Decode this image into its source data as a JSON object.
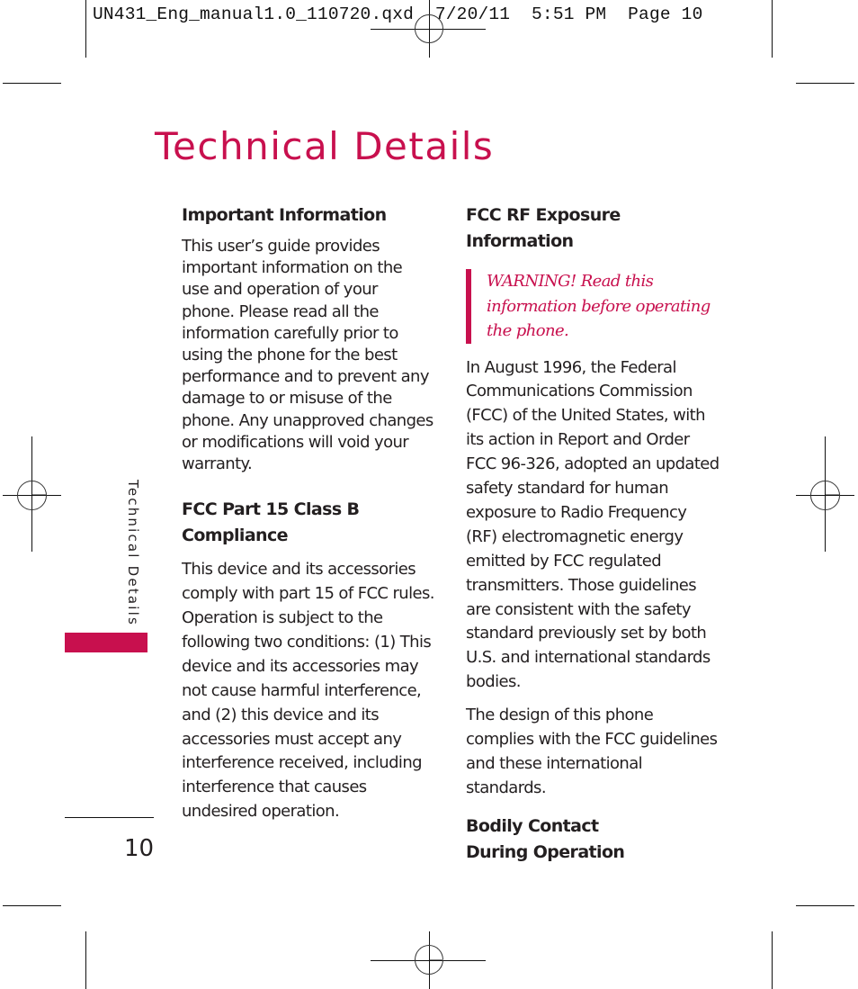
{
  "print_slug": {
    "filename": "UN431_Eng_manual1.0_110720.qxd",
    "date": "7/20/11",
    "time": "5:51 PM",
    "page_label": "Page 10"
  },
  "page": {
    "title": "Technical Details",
    "side_label": "Technical Details",
    "page_number": "10",
    "accent_color": "#c8104e"
  },
  "left_column": {
    "sections": [
      {
        "heading": "Important Information",
        "body": "This user’s guide provides important information on the use and operation of your phone. Please read all the information carefully prior to using the phone for the best performance and to prevent any damage to or misuse of the phone. Any unapproved changes or modifications will void your warranty."
      },
      {
        "heading": "FCC Part 15 Class B Compliance",
        "body": "This device and its accessories comply with part 15 of FCC rules. Operation is subject to the following two conditions: (1) This device and its accessories may not cause harmful interference, and (2) this device and its accessories must accept any interference received, including interference that causes undesired operation."
      }
    ]
  },
  "right_column": {
    "heading": "FCC RF Exposure Information",
    "warning": "WARNING! Read this information before operating the phone.",
    "paragraphs": [
      "In August 1996, the Federal Communications Commission (FCC) of the United States, with its action in Report and Order FCC 96-326, adopted an updated safety standard for human exposure to Radio Frequency (RF) electromagnetic energy emitted by FCC regulated transmitters. Those guidelines are consistent with the safety standard previously set by both U.S. and international standards bodies.",
      "The design of this phone complies with the FCC guidelines and these international standards."
    ],
    "next_heading": "Bodily Contact During Operation"
  }
}
